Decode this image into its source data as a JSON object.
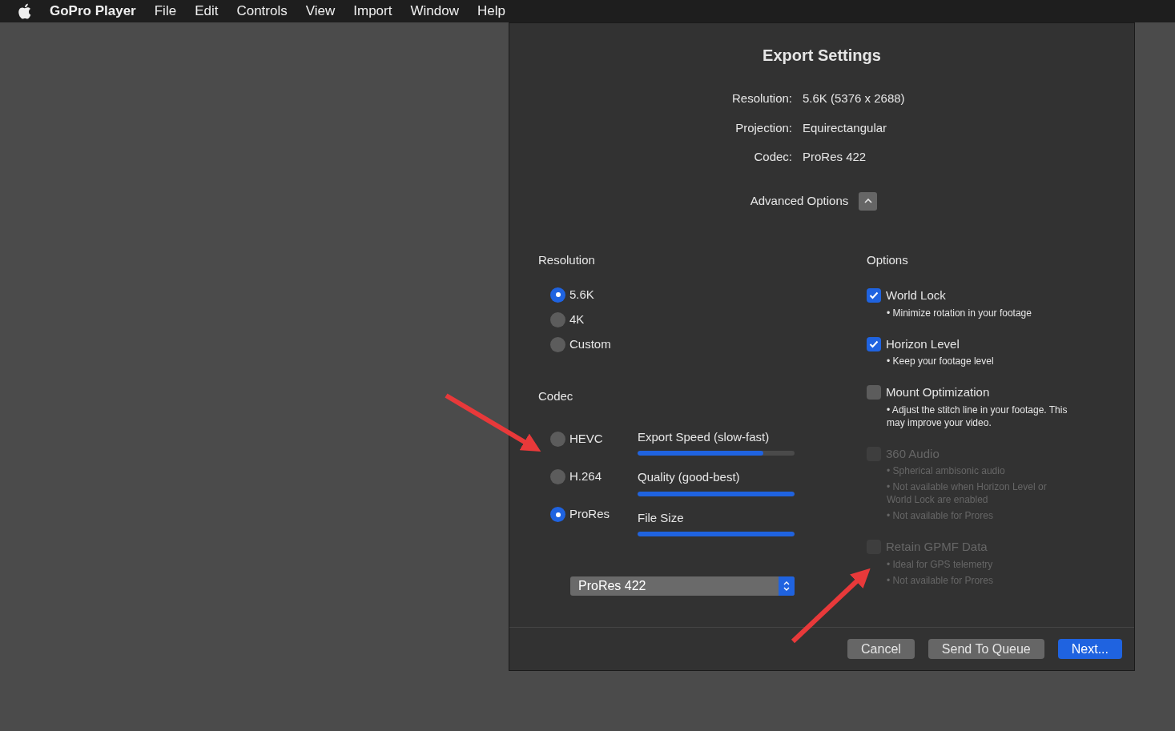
{
  "menu_bar": {
    "app_name": "GoPro Player",
    "items": [
      "File",
      "Edit",
      "Controls",
      "View",
      "Import",
      "Window",
      "Help"
    ]
  },
  "dialog": {
    "title": "Export Settings",
    "summary": [
      {
        "label": "Resolution:",
        "value": "5.6K (5376 x 2688)"
      },
      {
        "label": "Projection:",
        "value": "Equirectangular"
      },
      {
        "label": "Codec:",
        "value": "ProRes 422"
      }
    ],
    "advanced_options": {
      "label": "Advanced Options",
      "expanded": true
    },
    "resolution": {
      "heading": "Resolution",
      "options": [
        {
          "label": "5.6K",
          "selected": true
        },
        {
          "label": "4K",
          "selected": false
        },
        {
          "label": "Custom",
          "selected": false
        }
      ]
    },
    "codec": {
      "heading": "Codec",
      "options": [
        {
          "label": "HEVC",
          "selected": false
        },
        {
          "label": "H.264",
          "selected": false
        },
        {
          "label": "ProRes",
          "selected": true
        }
      ],
      "meters": [
        {
          "label": "Export Speed (slow-fast)",
          "level": 0.8
        },
        {
          "label": "Quality (good-best)",
          "level": 1
        },
        {
          "label": "File Size",
          "level": 1
        }
      ],
      "profile": {
        "value": "ProRes 422"
      }
    },
    "options": {
      "heading": "Options",
      "items": [
        {
          "label": "World Lock",
          "checked": true,
          "disabled": false,
          "notes": [
            "• Minimize rotation in your footage"
          ]
        },
        {
          "label": "Horizon Level",
          "checked": true,
          "disabled": false,
          "notes": [
            "• Keep your footage level"
          ]
        },
        {
          "label": "Mount Optimization",
          "checked": false,
          "disabled": false,
          "notes": [
            "• Adjust the stitch line in your footage. This may improve your video."
          ]
        },
        {
          "label": "360 Audio",
          "checked": false,
          "disabled": true,
          "notes": [
            "• Spherical ambisonic audio",
            "• Not available when Horizon Level or World Lock are enabled",
            "• Not available for Prores"
          ]
        },
        {
          "label": "Retain GPMF Data",
          "checked": false,
          "disabled": true,
          "notes": [
            "• Ideal for GPS telemetry",
            "• Not available for Prores"
          ]
        }
      ]
    },
    "buttons": [
      {
        "label": "Cancel",
        "kind": "secondary"
      },
      {
        "label": "Send To Queue",
        "kind": "secondary"
      },
      {
        "label": "Next...",
        "kind": "primary"
      }
    ]
  }
}
